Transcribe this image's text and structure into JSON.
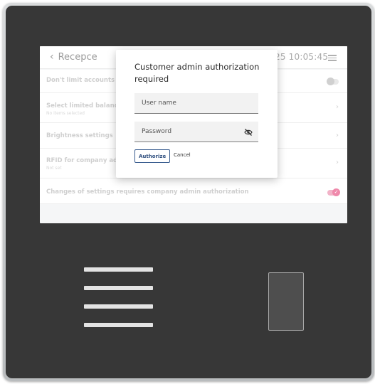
{
  "header": {
    "back_label": "Recepce",
    "clock": "25 10:05:45"
  },
  "settings": [
    {
      "label": "Don't limit accounts",
      "sub": "",
      "control": "toggle-off"
    },
    {
      "label": "Select limited balanc",
      "sub": "No items selected",
      "control": "chevron"
    },
    {
      "label": "Brightness settings",
      "sub": "",
      "control": "chevron"
    },
    {
      "label": "RFID for company ad",
      "sub": "Not set",
      "control": "chevron"
    },
    {
      "label": "Changes of settings requires company admin authorization",
      "sub": "",
      "control": "toggle-on"
    }
  ],
  "dialog": {
    "title": "Customer admin authorization required",
    "username_placeholder": "User name",
    "password_placeholder": "Password",
    "authorize_label": "Authorize",
    "cancel_label": "Cancel"
  },
  "icons": {
    "back": "chevron-left-icon",
    "menu": "hamburger-menu-icon",
    "password_visibility": "eye-off-icon"
  },
  "colors": {
    "device_face": "#373737",
    "toggle_on": "#ef89ab",
    "authorize_border": "#3a5d8f"
  }
}
